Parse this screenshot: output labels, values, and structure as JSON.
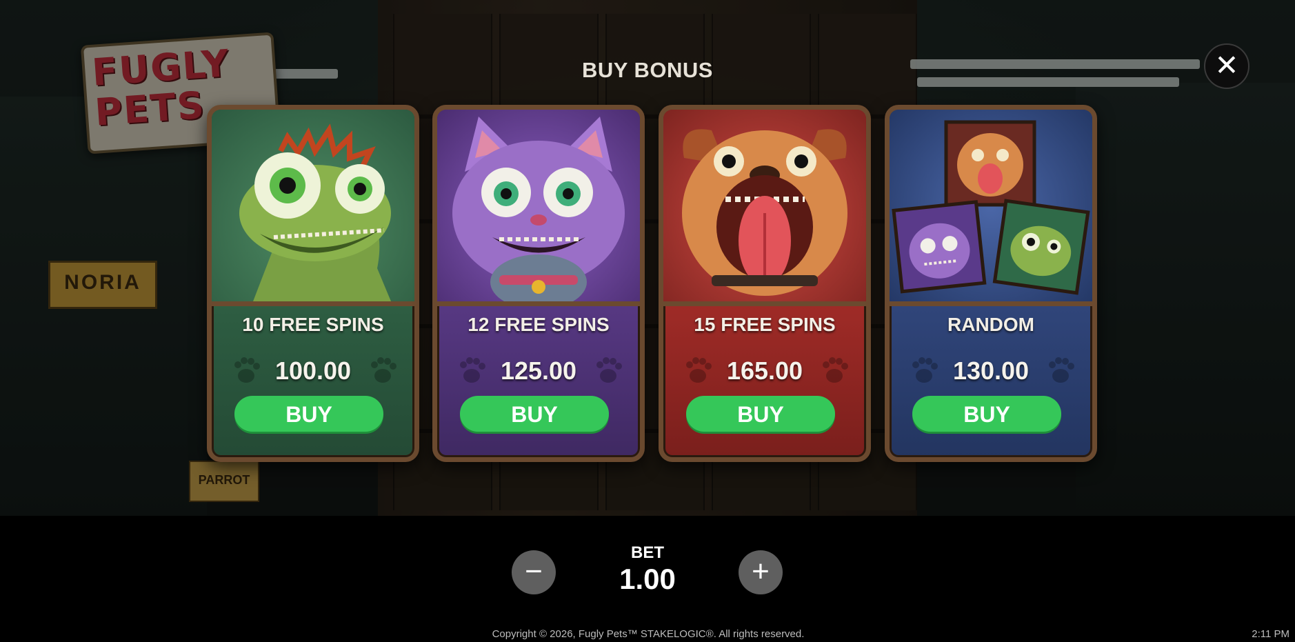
{
  "game": {
    "logo_text": "FUGLY PETS"
  },
  "dialog": {
    "title": "BUY BONUS",
    "close_icon": "close-icon"
  },
  "background": {
    "sign_left": "NORIA",
    "sign_parrot": "PARROT"
  },
  "options": [
    {
      "label": "10 FREE SPINS",
      "price": "100.00",
      "button": "BUY",
      "theme": "green",
      "color": "#2d5c41",
      "art": "lizard"
    },
    {
      "label": "12 FREE SPINS",
      "price": "125.00",
      "button": "BUY",
      "theme": "purple",
      "color": "#553780",
      "art": "cat"
    },
    {
      "label": "15 FREE SPINS",
      "price": "165.00",
      "button": "BUY",
      "theme": "red",
      "color": "#9c2a26",
      "art": "dog"
    },
    {
      "label": "RANDOM",
      "price": "130.00",
      "button": "BUY",
      "theme": "blue",
      "color": "#2f4478",
      "art": "collage"
    }
  ],
  "bet": {
    "label": "BET",
    "value": "1.00",
    "decrease_icon": "minus-icon",
    "increase_icon": "plus-icon"
  },
  "footer": {
    "copyright": "Copyright © 2026, Fugly Pets™ STAKELOGIC®. All rights reserved.",
    "time": "2:11 PM"
  },
  "colors": {
    "buy_button": "#35c759",
    "frame": "#6b4a2f"
  }
}
